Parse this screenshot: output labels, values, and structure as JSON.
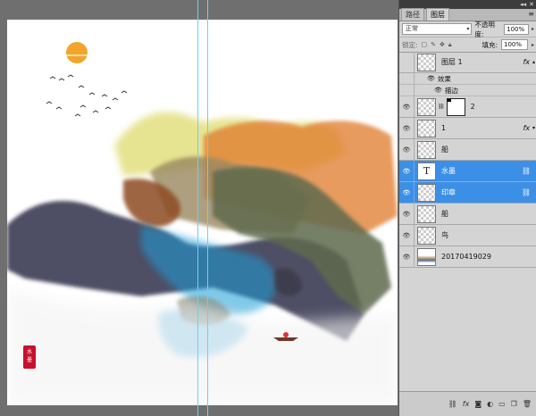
{
  "panel": {
    "top_icons": [
      "◂◂",
      "✕"
    ],
    "tabs": [
      {
        "label": "路径"
      },
      {
        "label": "图层"
      }
    ],
    "menu_icon": "≡",
    "blend_mode": "正常",
    "opacity_label": "不透明度:",
    "opacity_value": "100%",
    "lock_label": "锁定:",
    "fill_label": "填充:",
    "fill_value": "100%"
  },
  "layers": [
    {
      "name": "图层 1",
      "fx": "fx",
      "visible": false
    },
    {
      "name": "2",
      "visible": true
    },
    {
      "name": "1",
      "fx": "fx",
      "visible": true
    },
    {
      "name": "船",
      "visible": true
    },
    {
      "name": "水墨",
      "visible": true,
      "selected": true,
      "type": "text"
    },
    {
      "name": "印章",
      "visible": true,
      "selected": true
    },
    {
      "name": "船",
      "visible": true
    },
    {
      "name": "鸟",
      "visible": true
    },
    {
      "name": "20170419029",
      "visible": true
    }
  ],
  "effects": {
    "label": "效果",
    "stroke": "描边"
  },
  "seal_text": "水墨",
  "colors": {
    "selection": "#3b8fe6",
    "guide": "#5fd4ff"
  }
}
